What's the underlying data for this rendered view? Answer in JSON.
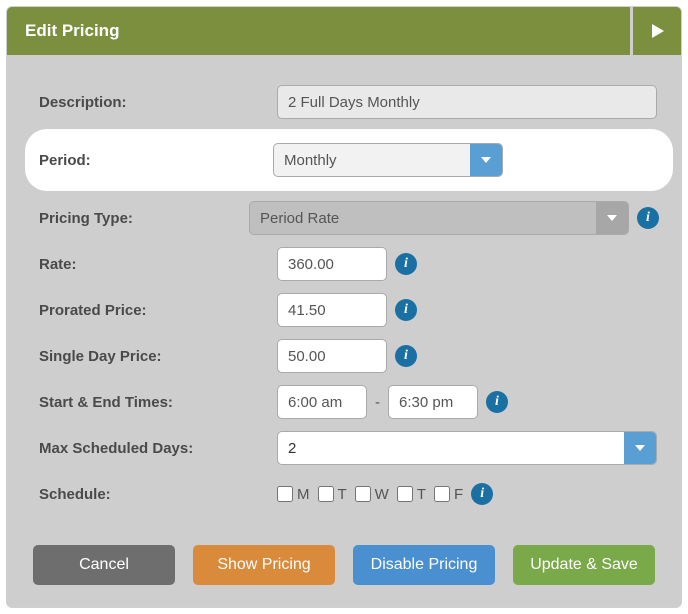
{
  "header": {
    "title": "Edit Pricing"
  },
  "labels": {
    "description": "Description:",
    "period": "Period:",
    "pricingType": "Pricing Type:",
    "rate": "Rate:",
    "proratedPrice": "Prorated Price:",
    "singleDayPrice": "Single Day Price:",
    "startEndTimes": "Start & End Times:",
    "maxScheduledDays": "Max Scheduled Days:",
    "schedule": "Schedule:"
  },
  "values": {
    "description": "2 Full Days Monthly",
    "period": "Monthly",
    "pricingType": "Period Rate",
    "rate": "360.00",
    "proratedPrice": "41.50",
    "singleDayPrice": "50.00",
    "startTime": "6:00 am",
    "endTime": "6:30 pm",
    "maxScheduledDays": "2",
    "timeSeparator": "-"
  },
  "schedule": {
    "days": [
      {
        "letter": "M",
        "checked": false
      },
      {
        "letter": "T",
        "checked": false
      },
      {
        "letter": "W",
        "checked": false
      },
      {
        "letter": "T",
        "checked": false
      },
      {
        "letter": "F",
        "checked": false
      }
    ]
  },
  "buttons": {
    "cancel": "Cancel",
    "showPricing": "Show Pricing",
    "disablePricing": "Disable Pricing",
    "updateSave": "Update & Save"
  },
  "info": "i"
}
